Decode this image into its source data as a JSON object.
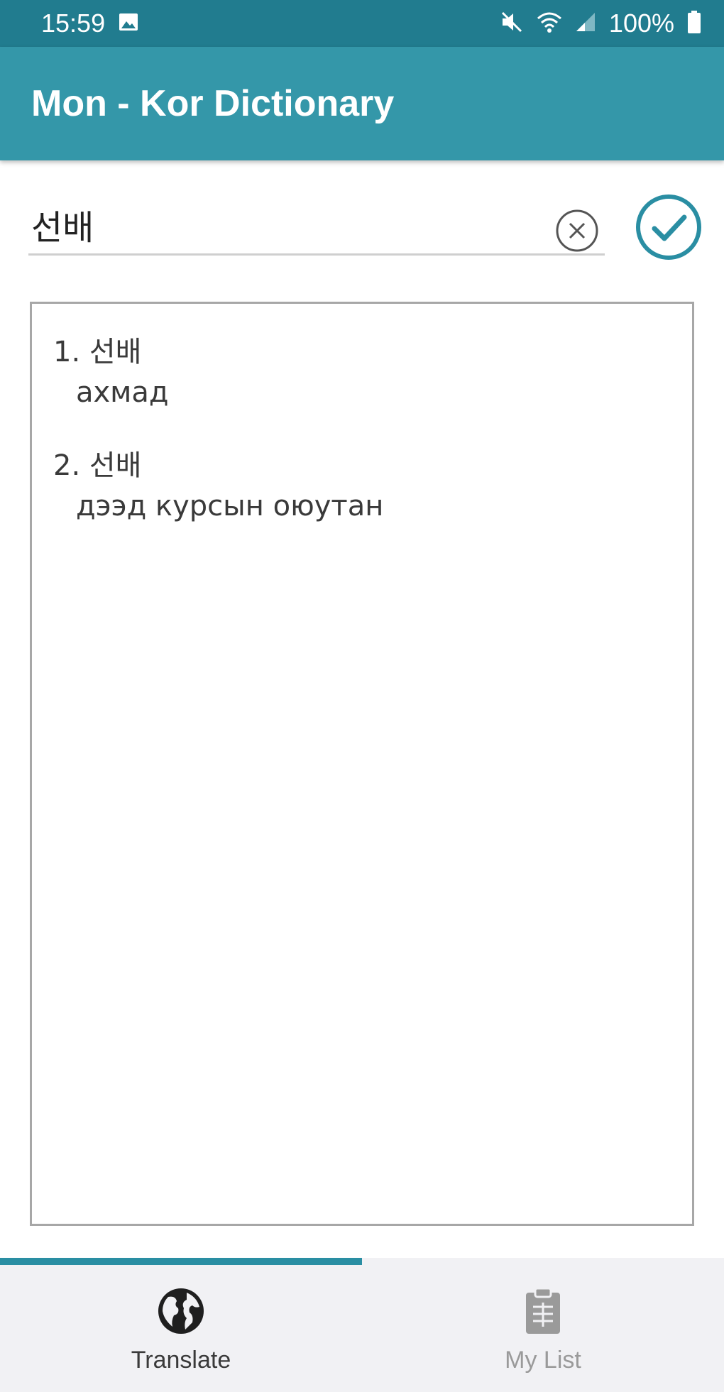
{
  "status_bar": {
    "time": "15:59",
    "battery": "100%",
    "icons": [
      "gallery-icon",
      "mute-icon",
      "wifi-icon",
      "signal-icon",
      "battery-icon"
    ]
  },
  "app": {
    "title": "Mon - Kor Dictionary",
    "accent_color": "#3497a9",
    "status_color": "#217c8f"
  },
  "search": {
    "value": "선배",
    "clear_icon": "clear-circle-icon",
    "confirm_icon": "check-circle-icon"
  },
  "results": [
    {
      "headword": "1. 선배",
      "meaning": "ахмад"
    },
    {
      "headword": "2. 선배",
      "meaning": "дээд курсын оюутан"
    }
  ],
  "bottom_nav": {
    "tabs": [
      {
        "label": "Translate",
        "icon": "globe-icon",
        "active": true
      },
      {
        "label": "My List",
        "icon": "clipboard-icon",
        "active": false
      }
    ]
  }
}
